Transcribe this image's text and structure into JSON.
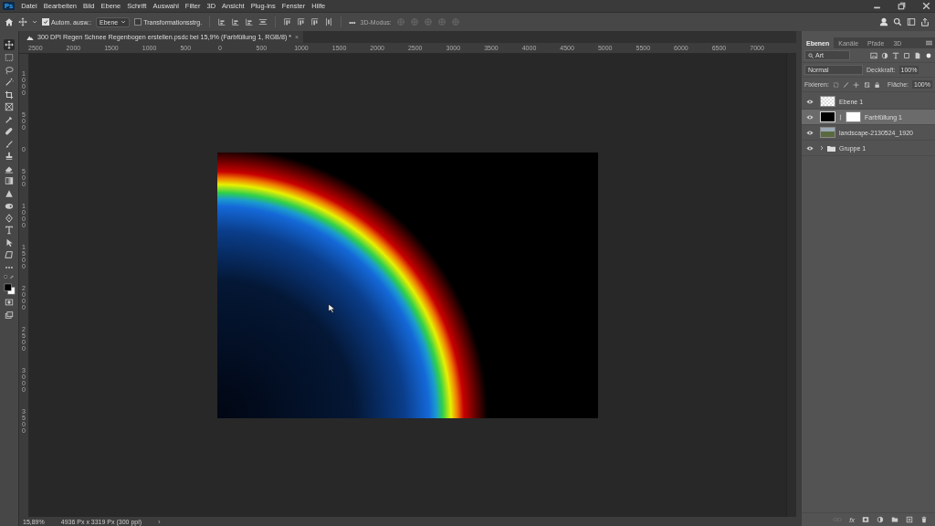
{
  "app": {
    "logo": "Ps"
  },
  "menu": [
    "Datei",
    "Bearbeiten",
    "Bild",
    "Ebene",
    "Schrift",
    "Auswahl",
    "Filter",
    "3D",
    "Ansicht",
    "Plug-ins",
    "Fenster",
    "Hilfe"
  ],
  "options": {
    "auto_select": {
      "label": "Autom. ausw.:",
      "checked": true
    },
    "target": "Ebene",
    "transform": {
      "label": "Transformationsstrg.",
      "checked": false
    },
    "more": "•••",
    "mode_3d": "3D-Modus:"
  },
  "document_tab": {
    "title": "300 DPI Regen Schnee Regenbogen erstellen.psdc bei 15,9% (Farbfüllung 1, RGB/8) *",
    "close": "×"
  },
  "ruler_h": [
    "2500",
    "2000",
    "1500",
    "1000",
    "500",
    "0",
    "500",
    "1000",
    "1500",
    "2000",
    "2500",
    "3000",
    "3500",
    "4000",
    "4500",
    "5000",
    "5500",
    "6000",
    "6500",
    "7000"
  ],
  "ruler_v": [
    "1000",
    "500",
    "0",
    "500",
    "1000",
    "1500",
    "2000",
    "2500",
    "3000",
    "3500"
  ],
  "status_bar": {
    "zoom": "15,89%",
    "size": "4936 Px x 3319 Px (300 ppi)",
    "arrow": "›"
  },
  "layers_panel": {
    "tabs": [
      {
        "label": "Ebenen",
        "selected": true
      },
      {
        "label": "Kanäle",
        "selected": false
      },
      {
        "label": "Pfade",
        "selected": false
      },
      {
        "label": "3D",
        "selected": false
      }
    ],
    "filter": "Art",
    "blend_mode": "Normal",
    "opacity_label": "Deckkraft:",
    "opacity": "100%",
    "lock_label": "Fixieren:",
    "fill_label": "Fläche:",
    "fill": "100%",
    "style_button": "fx",
    "layers": [
      {
        "kind": "pixel",
        "name": "Ebene 1",
        "visible": true,
        "selected": false
      },
      {
        "kind": "fill",
        "name": "Farbfüllung 1",
        "visible": true,
        "selected": true
      },
      {
        "kind": "image",
        "name": "landscape-2130524_1920",
        "visible": true,
        "selected": false
      },
      {
        "kind": "group",
        "name": "Gruppe 1",
        "visible": true,
        "selected": false
      }
    ]
  }
}
